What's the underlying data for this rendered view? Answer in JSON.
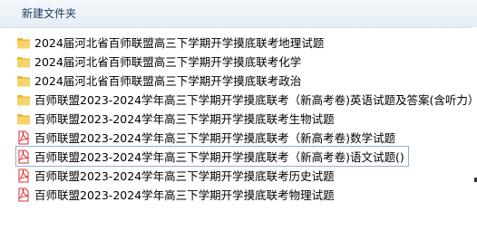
{
  "toolbar": {
    "new_folder_label": "新建文件夹"
  },
  "files": [
    {
      "type": "folder",
      "name": "2024届河北省百师联盟高三下学期开学摸底联考地理试题"
    },
    {
      "type": "folder",
      "name": "2024届河北省百师联盟高三下学期开学摸底联考化学"
    },
    {
      "type": "folder",
      "name": "2024届河北省百师联盟高三下学期开学摸底联考政治"
    },
    {
      "type": "folder",
      "name": "百师联盟2023-2024学年高三下学期开学摸底联考（新高考卷)英语试题及答案(含听力）"
    },
    {
      "type": "folder",
      "name": "百师联盟2023-2024学年高三下学期开学摸底联考生物试题"
    },
    {
      "type": "pdf",
      "name": "百师联盟2023-2024学年高三下学期开学摸底联考（新高考卷)数学试题"
    },
    {
      "type": "pdf",
      "name": "百师联盟2023-2024学年高三下学期开学摸底联考（新高考卷)语文试题()",
      "selected": true
    },
    {
      "type": "pdf",
      "name": "百师联盟2023-2024学年高三下学期开学摸底联考历史试题"
    },
    {
      "type": "pdf",
      "name": "百师联盟2023-2024学年高三下学期开学摸底联考物理试题"
    }
  ]
}
